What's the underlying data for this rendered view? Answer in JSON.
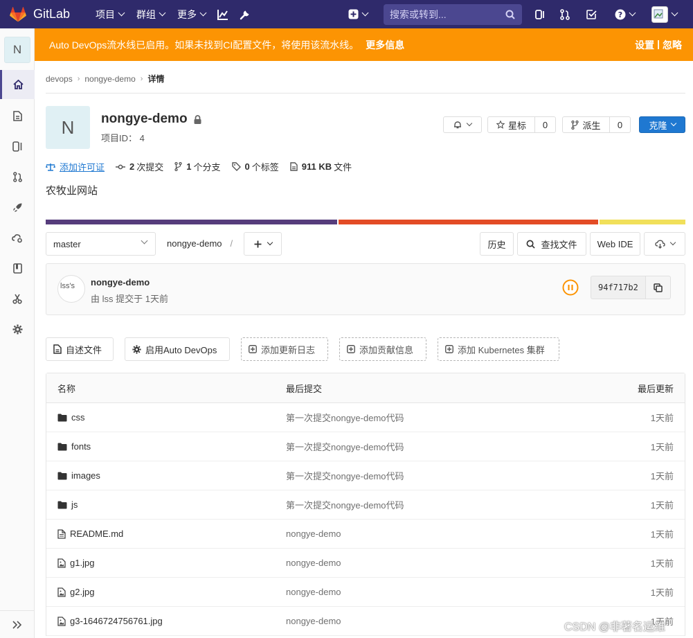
{
  "navbar": {
    "brand": "GitLab",
    "menu": [
      {
        "label": "项目"
      },
      {
        "label": "群组"
      },
      {
        "label": "更多"
      }
    ],
    "search_placeholder": "搜索或转到..."
  },
  "banner": {
    "text": "Auto DevOps流水线已启用。如果未找到CI配置文件，将使用该流水线。",
    "link": "更多信息",
    "settings": "设置",
    "divider": "|",
    "dismiss": "忽略"
  },
  "sidebar": {
    "avatar_letter": "N",
    "items": [
      "home-icon",
      "document-icon",
      "issues-icon",
      "merge-request-icon",
      "rocket-icon",
      "operations-icon",
      "wiki-icon",
      "snippets-icon",
      "settings-icon"
    ]
  },
  "breadcrumb": {
    "group": "devops",
    "project": "nongye-demo",
    "current": "详情"
  },
  "project": {
    "avatar_letter": "N",
    "name": "nongye-demo",
    "id_label": "项目ID： 4",
    "description": "农牧业网站",
    "star_label": "星标",
    "star_count": "0",
    "fork_label": "派生",
    "fork_count": "0",
    "clone_label": "克隆"
  },
  "stats": {
    "license": "添加许可证",
    "commits_count": "2",
    "commits_label": "次提交",
    "branches_count": "1",
    "branches_label": "个分支",
    "tags_count": "0",
    "tags_label": "个标签",
    "size_value": "911 KB",
    "size_label": "文件"
  },
  "languages": [
    {
      "color": "#563d7c",
      "fraction": 0.456
    },
    {
      "color": "#e34c26",
      "fraction": 0.408
    },
    {
      "color": "#f1e05a",
      "fraction": 0.136
    }
  ],
  "tree": {
    "branch": "master",
    "path": "nongye-demo",
    "slash": "/",
    "history": "历史",
    "find_file": "查找文件",
    "web_ide": "Web IDE"
  },
  "commit": {
    "avatar_alt": "lss's",
    "title": "nongye-demo",
    "meta": "由 lss 提交于 1天前",
    "sha": "94f717b2"
  },
  "quick_actions": {
    "readme": "自述文件",
    "autodevops": "启用Auto DevOps",
    "changelog": "添加更新日志",
    "contributing": "添加贡献信息",
    "kubernetes": "添加 Kubernetes 集群"
  },
  "files": {
    "headers": {
      "name": "名称",
      "last_commit": "最后提交",
      "last_update": "最后更新"
    },
    "rows": [
      {
        "name": "css",
        "type": "folder",
        "commit": "第一次提交nongye-demo代码",
        "time": "1天前"
      },
      {
        "name": "fonts",
        "type": "folder",
        "commit": "第一次提交nongye-demo代码",
        "time": "1天前"
      },
      {
        "name": "images",
        "type": "folder",
        "commit": "第一次提交nongye-demo代码",
        "time": "1天前"
      },
      {
        "name": "js",
        "type": "folder",
        "commit": "第一次提交nongye-demo代码",
        "time": "1天前"
      },
      {
        "name": "README.md",
        "type": "text",
        "commit": "nongye-demo",
        "time": "1天前"
      },
      {
        "name": "g1.jpg",
        "type": "image",
        "commit": "nongye-demo",
        "time": "1天前"
      },
      {
        "name": "g2.jpg",
        "type": "image",
        "commit": "nongye-demo",
        "time": "1天前"
      },
      {
        "name": "g3-1646724756761.jpg",
        "type": "image",
        "commit": "nongye-demo",
        "time": "1天前"
      }
    ]
  },
  "watermark": "CSDN @非著名运维"
}
